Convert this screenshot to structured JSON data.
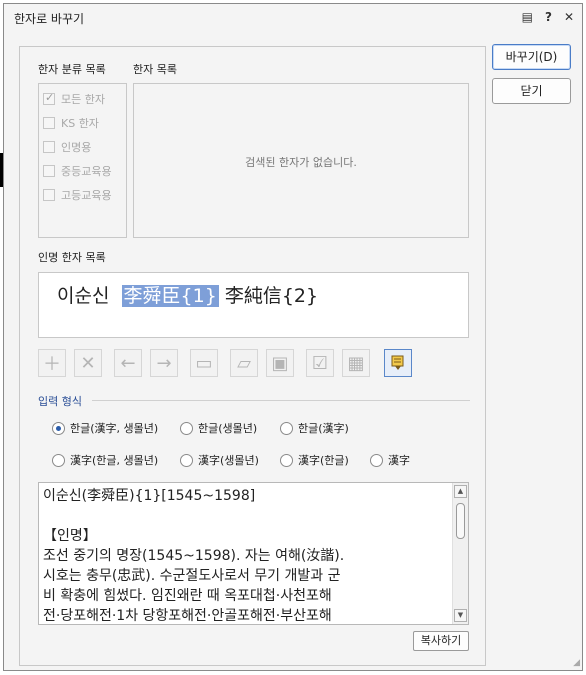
{
  "window": {
    "title": "한자로 바꾸기",
    "icons": [
      "comment-icon",
      "help-icon",
      "close-icon"
    ],
    "icon_glyphs": {
      "comment": "▤",
      "help": "?",
      "close": "✕"
    }
  },
  "buttons": {
    "convert": "바꾸기(D)",
    "close": "닫기",
    "copy": "복사하기"
  },
  "category_list": {
    "label": "한자 분류 목록",
    "items": [
      {
        "label": "모든 한자",
        "checked": true
      },
      {
        "label": "KS 한자",
        "checked": false
      },
      {
        "label": "인명용",
        "checked": false
      },
      {
        "label": "중등교육용",
        "checked": false
      },
      {
        "label": "고등교육용",
        "checked": false
      }
    ]
  },
  "hanja_list": {
    "label": "한자 목록",
    "empty_message": "검색된 한자가 없습니다."
  },
  "person_name_list": {
    "label": "인명 한자 목록",
    "prefix": "이순신  ",
    "selected": "李舜臣{1}",
    "suffix": " 李純信{2}"
  },
  "toolbar": {
    "icons": [
      "add-icon",
      "delete-icon",
      "move-left-icon",
      "move-right-icon",
      "open-dictionary-icon",
      "open-folder-icon",
      "save-icon",
      "check-list-icon",
      "grid-icon",
      "dictionary-down-icon"
    ],
    "active_icon": "dictionary-down-icon"
  },
  "input_format": {
    "label": "입력 형식",
    "row1": [
      {
        "label": "한글(漢字, 생몰년)",
        "selected": true
      },
      {
        "label": "한글(생몰년)",
        "selected": false
      },
      {
        "label": "한글(漢字)",
        "selected": false
      }
    ],
    "row2": [
      {
        "label": "漢字(한글, 생몰년)",
        "selected": false
      },
      {
        "label": "漢字(생몰년)",
        "selected": false
      },
      {
        "label": "漢字(한글)",
        "selected": false
      },
      {
        "label": "漢字",
        "selected": false
      }
    ]
  },
  "description": {
    "line1": "이순신(李舜臣){1}[1545~1598]",
    "line2": "",
    "line3": "【인명】",
    "line4": "조선 중기의 명장(1545~1598). 자는 여해(汝諧).",
    "line5": "시호는 충무(忠武). 수군절도사로서 무기 개발과 군",
    "line6": "비 확충에 힘썼다. 임진왜란 때 옥포대첩·사천포해",
    "line7": "전·당포해전·1차 당항포해전·안골포해전·부산포해"
  },
  "colors": {
    "accent": "#2a4e96",
    "selection": "#7e9fd8",
    "background": "#f4f4f4"
  }
}
